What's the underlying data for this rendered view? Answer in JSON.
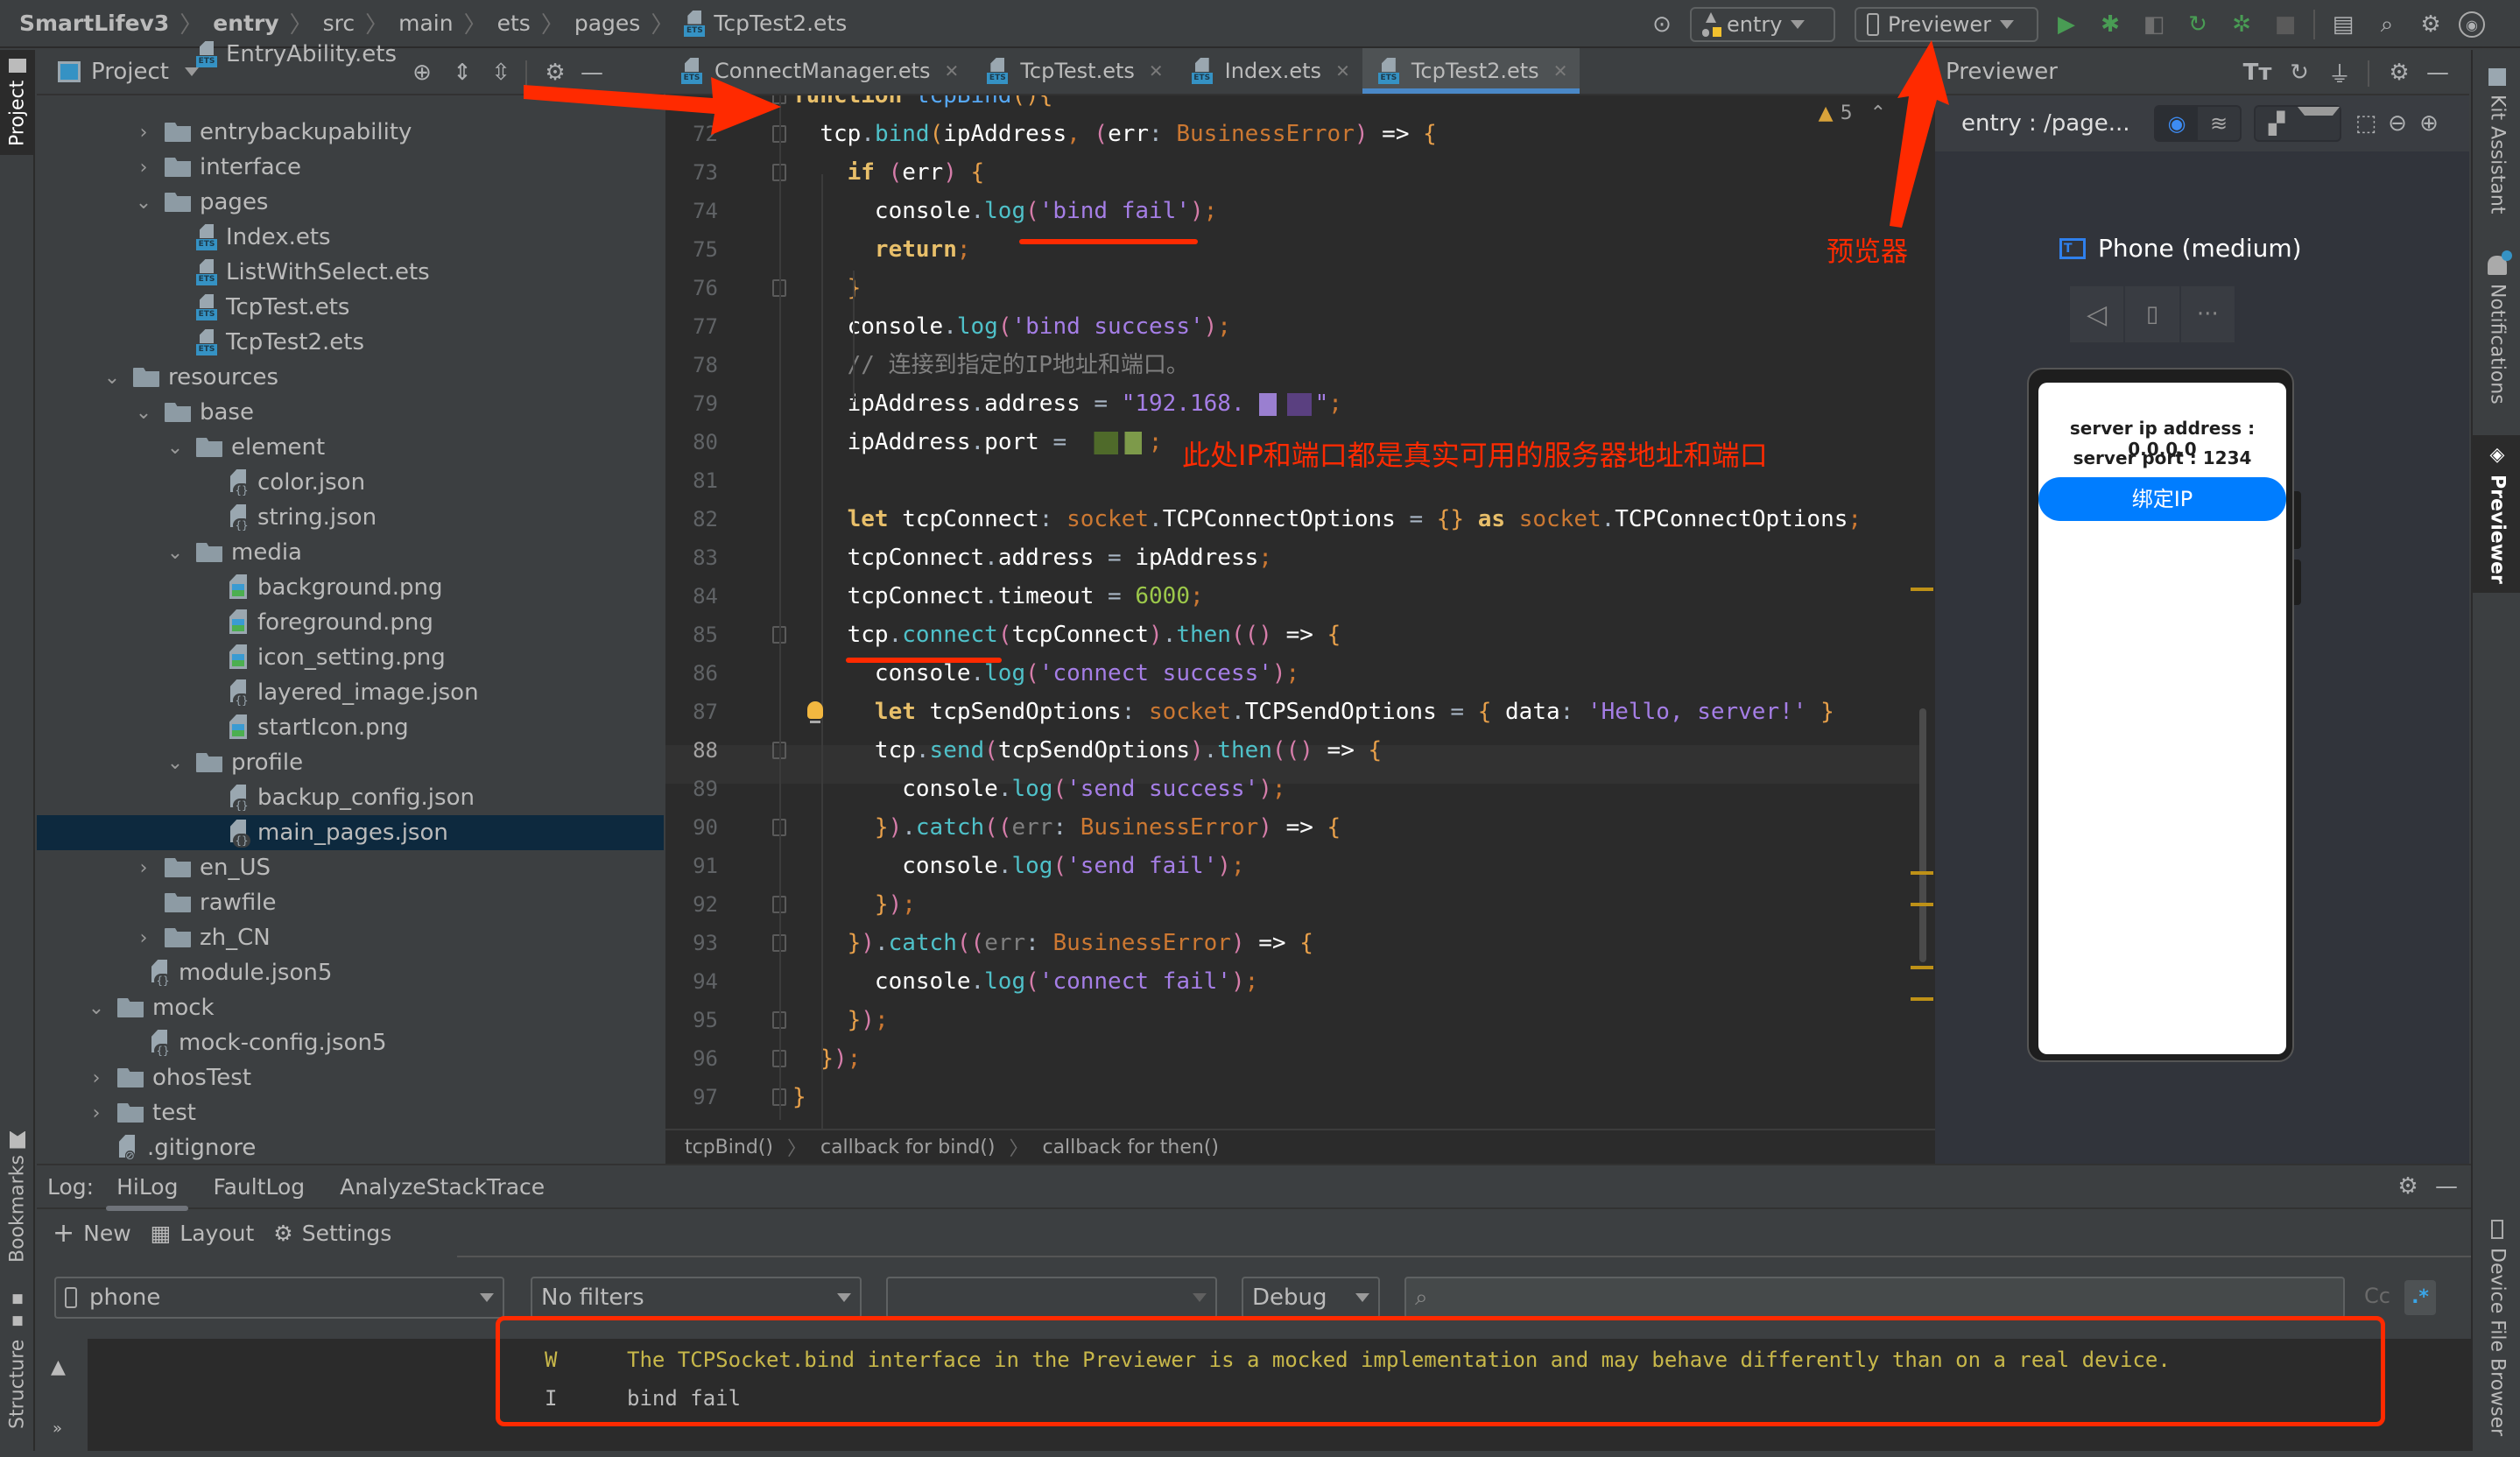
{
  "breadcrumbs": [
    "SmartLifev3",
    "entry",
    "src",
    "main",
    "ets",
    "pages",
    "TcpTest2.ets"
  ],
  "toolbar": {
    "module_select": "entry",
    "device_select": "Previewer",
    "icons": [
      "locate-icon",
      "run-icon",
      "debug-icon",
      "attach-icon",
      "reload-icon",
      "profiler-icon",
      "stop-icon",
      "project-structure-icon",
      "search-icon",
      "settings-icon",
      "account-icon"
    ]
  },
  "left_stripe": {
    "project": "Project",
    "bookmarks": "Bookmarks",
    "structure": "Structure"
  },
  "right_stripe": {
    "kit_assistant": "Kit Assistant",
    "notifications": "Notifications",
    "previewer": "Previewer",
    "device_file_browser": "Device File Browser"
  },
  "project_panel": {
    "title": "Project",
    "tree": [
      {
        "label": "EntryAbility.ets",
        "type": "ets",
        "depth": 3,
        "expander": "none"
      },
      {
        "label": "entrybackupability",
        "type": "folder",
        "depth": 2,
        "expander": "closed"
      },
      {
        "label": "interface",
        "type": "folder",
        "depth": 2,
        "expander": "closed"
      },
      {
        "label": "pages",
        "type": "folder",
        "depth": 2,
        "expander": "open"
      },
      {
        "label": "Index.ets",
        "type": "ets",
        "depth": 3,
        "expander": "none"
      },
      {
        "label": "ListWithSelect.ets",
        "type": "ets",
        "depth": 3,
        "expander": "none"
      },
      {
        "label": "TcpTest.ets",
        "type": "ets",
        "depth": 3,
        "expander": "none"
      },
      {
        "label": "TcpTest2.ets",
        "type": "ets",
        "depth": 3,
        "expander": "none"
      },
      {
        "label": "resources",
        "type": "folder",
        "depth": 1,
        "expander": "open"
      },
      {
        "label": "base",
        "type": "folder",
        "depth": 2,
        "expander": "open"
      },
      {
        "label": "element",
        "type": "folder",
        "depth": 3,
        "expander": "open"
      },
      {
        "label": "color.json",
        "type": "json",
        "depth": 4,
        "expander": "none"
      },
      {
        "label": "string.json",
        "type": "json",
        "depth": 4,
        "expander": "none"
      },
      {
        "label": "media",
        "type": "folder",
        "depth": 3,
        "expander": "open"
      },
      {
        "label": "background.png",
        "type": "png",
        "depth": 4,
        "expander": "none"
      },
      {
        "label": "foreground.png",
        "type": "png",
        "depth": 4,
        "expander": "none"
      },
      {
        "label": "icon_setting.png",
        "type": "png",
        "depth": 4,
        "expander": "none"
      },
      {
        "label": "layered_image.json",
        "type": "json",
        "depth": 4,
        "expander": "none"
      },
      {
        "label": "startIcon.png",
        "type": "png",
        "depth": 4,
        "expander": "none"
      },
      {
        "label": "profile",
        "type": "folder",
        "depth": 3,
        "expander": "open"
      },
      {
        "label": "backup_config.json",
        "type": "json",
        "depth": 4,
        "expander": "none"
      },
      {
        "label": "main_pages.json",
        "type": "json",
        "depth": 4,
        "expander": "none",
        "selected": true
      },
      {
        "label": "en_US",
        "type": "folder",
        "depth": 2,
        "expander": "closed"
      },
      {
        "label": "rawfile",
        "type": "folder",
        "depth": 2,
        "expander": "none"
      },
      {
        "label": "zh_CN",
        "type": "folder",
        "depth": 2,
        "expander": "closed"
      },
      {
        "label": "module.json5",
        "type": "json",
        "depth": 1.5,
        "expander": "none"
      },
      {
        "label": "mock",
        "type": "folder",
        "depth": 0.5,
        "expander": "open"
      },
      {
        "label": "mock-config.json5",
        "type": "json",
        "depth": 1.5,
        "expander": "none"
      },
      {
        "label": "ohosTest",
        "type": "folder",
        "depth": 0.5,
        "expander": "closed"
      },
      {
        "label": "test",
        "type": "folder",
        "depth": 0.5,
        "expander": "closed"
      },
      {
        "label": ".gitignore",
        "type": "git",
        "depth": 0.5,
        "expander": "none"
      }
    ]
  },
  "editor": {
    "tabs": [
      {
        "label": "ConnectManager.ets",
        "active": false
      },
      {
        "label": "TcpTest.ets",
        "active": false
      },
      {
        "label": "Index.ets",
        "active": false
      },
      {
        "label": "TcpTest2.ets",
        "active": true
      }
    ],
    "warning_count": "5",
    "current_line": 88,
    "lines": [
      {
        "num": "",
        "html": "<span class='k'>function</span> <span class='fn'>tcpBind</span><span class='p1'>()</span><span class='p1'>{</span>"
      },
      {
        "num": "72",
        "html": "  <span class='id'>tcp</span>.<span class='m'>bind</span><span class='p1'>(</span><span class='id'>ipAddress</span><span class='semi'>,</span> <span class='p2'>(</span><span class='id'>err</span>: <span class='t'>BusinessError</span><span class='p2'>)</span> <span class='id'>=&gt;</span> <span class='p1'>{</span>"
      },
      {
        "num": "73",
        "html": "    <span class='k'>if</span> <span class='p2'>(</span><span class='id'>err</span><span class='p2'>)</span> <span class='p1'>{</span>"
      },
      {
        "num": "74",
        "html": "      <span class='id'>console</span>.<span class='m'>log</span><span class='p2'>(</span><span class='s'>'bind fail'</span><span class='p2'>)</span><span class='semi'>;</span>"
      },
      {
        "num": "75",
        "html": "      <span class='k'>return</span><span class='semi'>;</span>"
      },
      {
        "num": "76",
        "html": "    <span class='p1'>}</span>"
      },
      {
        "num": "77",
        "html": "    <span class='id'>console</span>.<span class='m'>log</span><span class='p2'>(</span><span class='s'>'bind success'</span><span class='p2'>)</span><span class='semi'>;</span>"
      },
      {
        "num": "78",
        "html": "    <span class='c'>// 连接到指定的IP地址和端口。</span>"
      },
      {
        "num": "79",
        "html": "    <span class='id'>ipAddress</span>.<span class='id'>address</span> = <span class='s'>\"192.168.</span><span class='blur' style='width:80px;background:linear-gradient(90deg,#2b2b2b 0 20%,#9a7fd0 20% 45%,#2b2b2b 45% 60%,#5a4080 60% 95%,#2b2b2b 95%)'></span><span class='s'>\"</span><span class='semi'>;</span>"
      },
      {
        "num": "80",
        "html": "    <span class='id'>ipAddress</span>.<span class='id'>port</span> = <span class='blur' style='width:78px;background:linear-gradient(90deg,#2b2b2b 0 20%,#4f6a2a 20% 55%,#2b2b2b 55% 65%,#7d9a4a 65% 90%,#2b2b2b 90%)'></span><span class='semi'>;</span>"
      },
      {
        "num": "81",
        "html": ""
      },
      {
        "num": "82",
        "html": "    <span class='k'>let</span> <span class='id'>tcpConnect</span>: <span class='t'>socket</span>.<span class='id'>TCPConnectOptions</span> = <span class='p1'>{}</span> <span class='k'>as</span> <span class='t'>socket</span>.<span class='id'>TCPConnectOptions</span><span class='semi'>;</span>"
      },
      {
        "num": "83",
        "html": "    <span class='id'>tcpConnect</span>.<span class='id'>address</span> = <span class='id'>ipAddress</span><span class='semi'>;</span>"
      },
      {
        "num": "84",
        "html": "    <span class='id'>tcpConnect</span>.<span class='id'>timeout</span> = <span class='n'>6000</span><span class='semi'>;</span>"
      },
      {
        "num": "85",
        "html": "    <span class='id'>tcp</span>.<span class='m'>connect</span><span class='p2'>(</span><span class='id'>tcpConnect</span><span class='p2'>)</span>.<span class='m'>then</span><span class='p2'>(()</span> <span class='id'>=&gt;</span> <span class='p1'>{</span>"
      },
      {
        "num": "86",
        "html": "      <span class='id'>console</span>.<span class='m'>log</span><span class='p2'>(</span><span class='s'>'connect success'</span><span class='p2'>)</span><span class='semi'>;</span>"
      },
      {
        "num": "87",
        "html": "      <span class='k'>let</span> <span class='id'>tcpSendOptions</span>: <span class='t'>socket</span>.<span class='id'>TCPSendOptions</span> = <span class='p1'>{</span> <span class='id'>data</span>: <span class='s'>'Hello, server!'</span> <span class='p1'>}</span>"
      },
      {
        "num": "88",
        "html": "      <span class='id'>tcp</span>.<span class='m'>send</span><span class='p2'>(</span><span class='id'>tcpSendOptions</span><span class='p2'>)</span>.<span class='m'>then</span><span class='p2'>(()</span> <span class='id'>=&gt;</span> <span class='p1'>{</span>"
      },
      {
        "num": "89",
        "html": "        <span class='id'>console</span>.<span class='m'>log</span><span class='p2'>(</span><span class='s'>'send success'</span><span class='p2'>)</span><span class='semi'>;</span>"
      },
      {
        "num": "90",
        "html": "      <span class='p1'>}</span><span class='p2'>)</span>.<span class='m'>catch</span><span class='p2'>((</span><span class='dim'>err</span>: <span class='t'>BusinessError</span><span class='p2'>)</span> <span class='id'>=&gt;</span> <span class='p1'>{</span>"
      },
      {
        "num": "91",
        "html": "        <span class='id'>console</span>.<span class='m'>log</span><span class='p2'>(</span><span class='s'>'send fail'</span><span class='p2'>)</span><span class='semi'>;</span>"
      },
      {
        "num": "92",
        "html": "      <span class='p1'>}</span><span class='p2'>)</span><span class='semi'>;</span>"
      },
      {
        "num": "93",
        "html": "    <span class='p1'>}</span><span class='p2'>)</span>.<span class='m'>catch</span><span class='p2'>((</span><span class='dim'>err</span>: <span class='t'>BusinessError</span><span class='p2'>)</span> <span class='id'>=&gt;</span> <span class='p1'>{</span>"
      },
      {
        "num": "94",
        "html": "      <span class='id'>console</span>.<span class='m'>log</span><span class='p2'>(</span><span class='s'>'connect fail'</span><span class='p2'>)</span><span class='semi'>;</span>"
      },
      {
        "num": "95",
        "html": "    <span class='p1'>}</span><span class='p2'>)</span><span class='semi'>;</span>"
      },
      {
        "num": "96",
        "html": "  <span class='p1'>}</span><span class='p2'>)</span><span class='semi'>;</span>"
      },
      {
        "num": "97",
        "html": "<span class='p1'>}</span>"
      }
    ],
    "breadcrumb": [
      "tcpBind()",
      "callback for bind()",
      "callback for then()"
    ]
  },
  "previewer": {
    "title": "Previewer",
    "page_path": "entry : /page...",
    "device_name": "Phone (medium)",
    "app": {
      "ip_label": "server ip address : 0.0.0.0",
      "port_label": "server port : 1234",
      "bind_button": "绑定IP"
    }
  },
  "log_panel": {
    "label": "Log:",
    "tabs": [
      {
        "label": "HiLog",
        "active": true
      },
      {
        "label": "FaultLog",
        "active": false
      },
      {
        "label": "AnalyzeStackTrace",
        "active": false
      }
    ],
    "actions": {
      "new": "New",
      "layout": "Layout",
      "settings": "Settings"
    },
    "device_select": "phone",
    "filter_select": "No filters",
    "process_select": "",
    "level_select": "Debug",
    "search_placeholder": "",
    "case_toggle": "Cc",
    "regex_toggle": ".*",
    "entries": [
      {
        "level": "W",
        "message": "The TCPSocket.bind interface in the Previewer is a mocked implementation and may behave differently than on a real device.",
        "color": "#c8b84a"
      },
      {
        "level": "I",
        "message": "bind fail",
        "color": "#bbbbbb"
      }
    ]
  },
  "annotations": {
    "previewer_label": "预览器",
    "ip_port_note": "此处IP和端口都是真实可用的服务器地址和端口",
    "color": "#ff2a00"
  }
}
